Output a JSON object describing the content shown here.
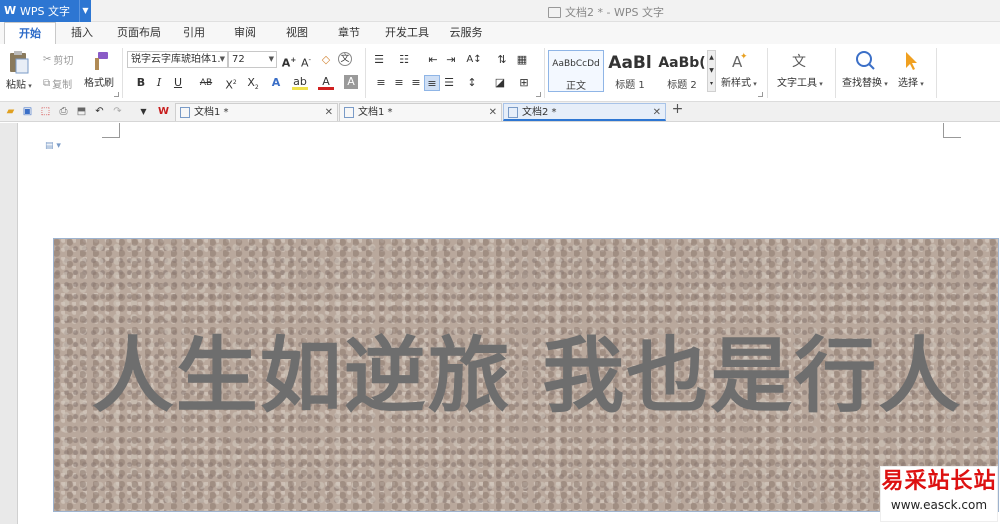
{
  "app": {
    "name": "WPS 文字",
    "logo": "W",
    "title": "文档2 * - WPS 文字"
  },
  "menu": [
    "开始",
    "插入",
    "页面布局",
    "引用",
    "审阅",
    "视图",
    "章节",
    "开发工具",
    "云服务"
  ],
  "ribbon": {
    "clipboard": {
      "paste": "粘贴",
      "cut": "剪切",
      "copy": "复制",
      "format_painter": "格式刷"
    },
    "font": {
      "family": "锐字云字库琥珀体1.",
      "size": "72"
    },
    "styles": [
      {
        "sample": "AaBbCcDd",
        "name": "正文"
      },
      {
        "sample": "AaBl",
        "name": "标题 1"
      },
      {
        "sample": "AaBb(",
        "name": "标题 2"
      }
    ],
    "new_style": "新样式",
    "text_tools": "文字工具",
    "find_replace": "查找替换",
    "select": "选择"
  },
  "doc_tabs": [
    {
      "label": "文档1 *",
      "active": false
    },
    {
      "label": "文档1 *",
      "active": false
    },
    {
      "label": "文档2 *",
      "active": true
    }
  ],
  "document": {
    "banner_text": "人生如逆旅 我也是行人"
  },
  "watermark": {
    "line1": "易采站长站",
    "line2": "www.easck.com"
  },
  "colors": {
    "accent": "#2d76d2",
    "banner_text": "#6e6e6e",
    "watermark_red": "#dd1111"
  }
}
